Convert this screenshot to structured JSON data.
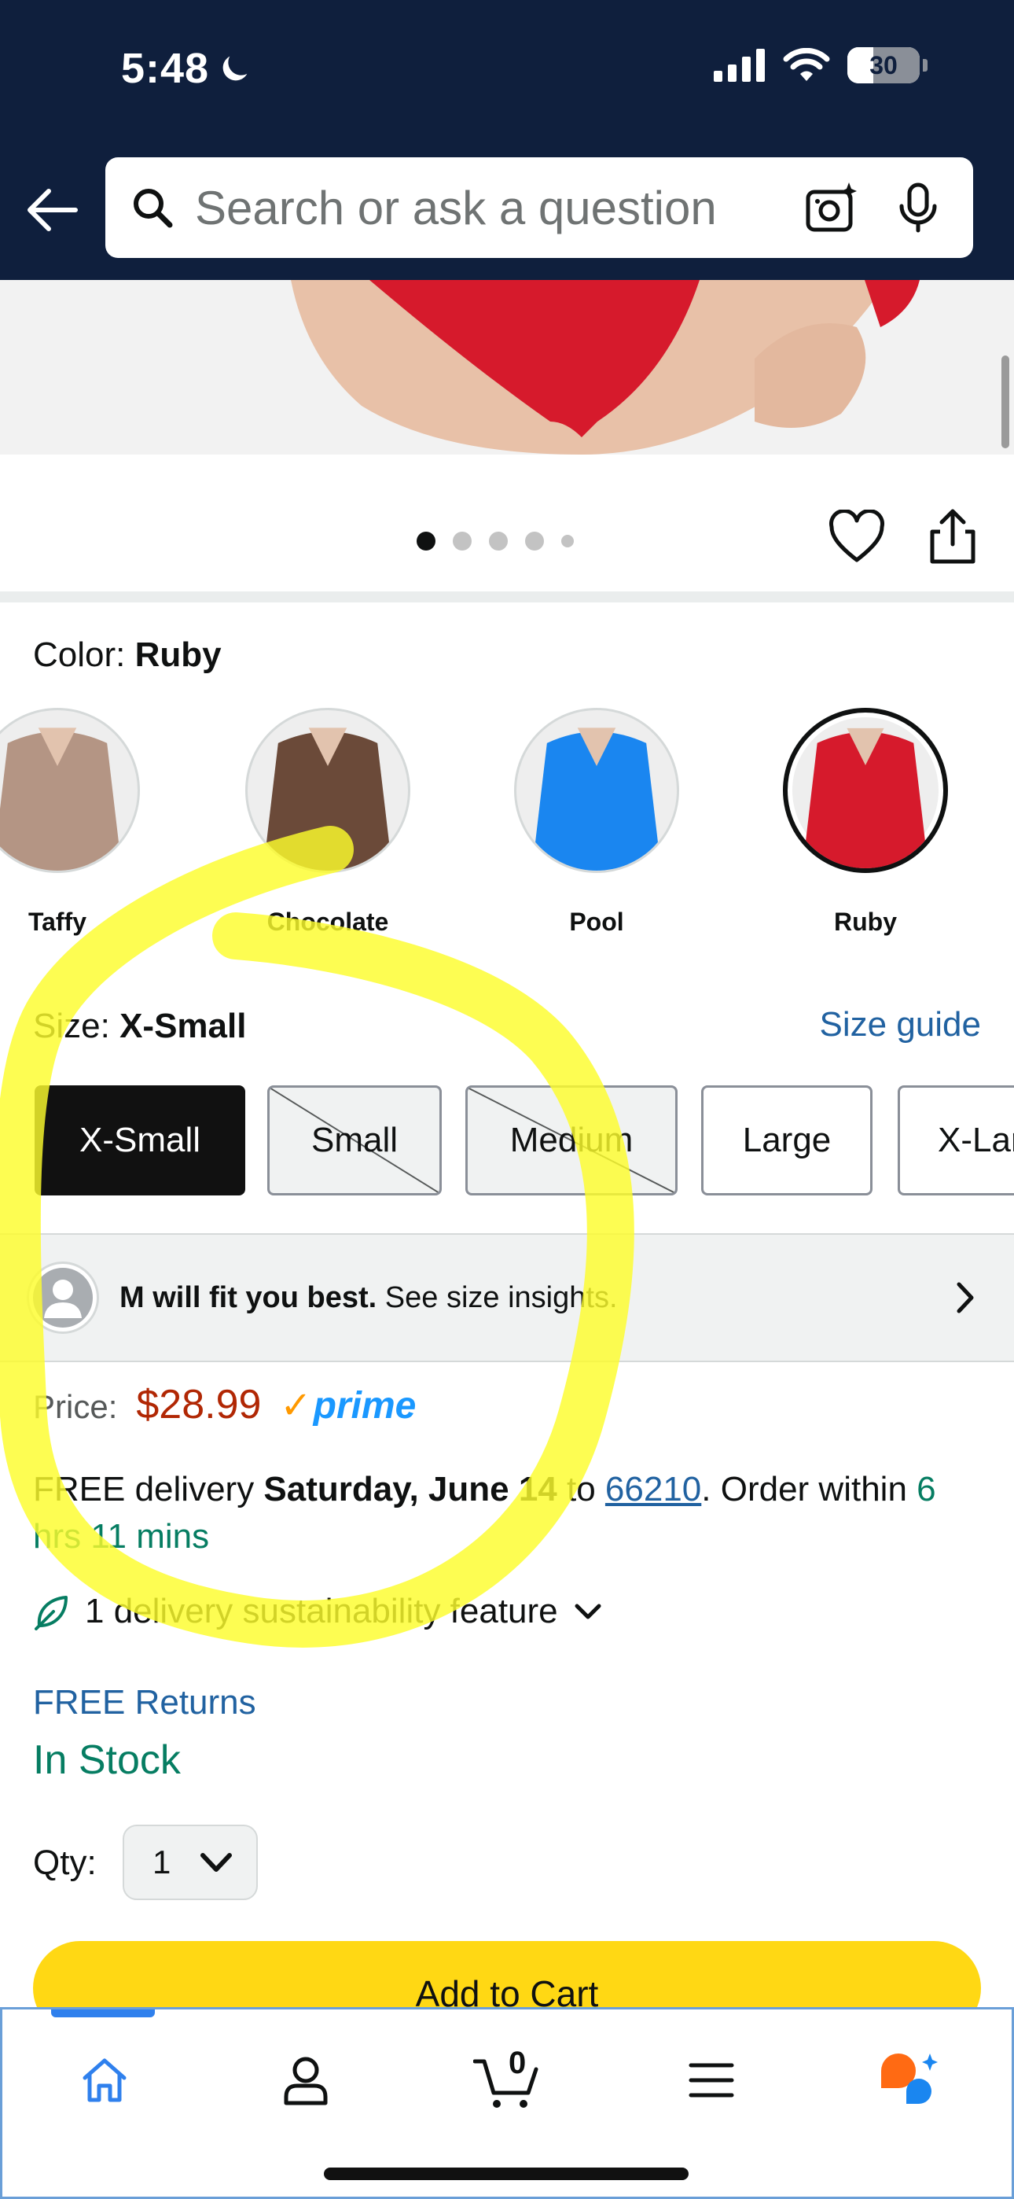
{
  "status_bar": {
    "time": "5:48",
    "battery": "30"
  },
  "search": {
    "placeholder": "Search or ask a question"
  },
  "gallery": {
    "dot_count": 5,
    "active_index": 0
  },
  "color": {
    "label": "Color:",
    "selected": "Ruby",
    "swatches": [
      {
        "name": "Taffy",
        "color": "#b49584"
      },
      {
        "name": "Chocolate",
        "color": "#6b4a39"
      },
      {
        "name": "Pool",
        "color": "#1a86f0"
      },
      {
        "name": "Ruby",
        "color": "#d61a2c"
      }
    ]
  },
  "size": {
    "label": "Size:",
    "selected": "X-Small",
    "guide_link": "Size guide",
    "options": [
      "X-Small",
      "Small",
      "Medium",
      "Large",
      "X-Large"
    ]
  },
  "fit_insight": {
    "bold": "M will fit you best.",
    "link": "See size insights."
  },
  "price": {
    "label": "Price:",
    "amount": "$28.99",
    "badge": "prime"
  },
  "delivery": {
    "prefix": "FREE delivery ",
    "date": "Saturday, June 14",
    "to": " to ",
    "zip": "66210",
    "order_within": ". Order within ",
    "countdown": "6 hrs 11 mins"
  },
  "sustainability": {
    "label": "1 delivery sustainability feature"
  },
  "returns": {
    "label": "FREE Returns"
  },
  "stock": {
    "label": "In Stock"
  },
  "quantity": {
    "label": "Qty:",
    "value": "1"
  },
  "cart_button": {
    "label": "Add to Cart"
  },
  "bottom_nav": {
    "cart_count": "0"
  },
  "colors": {
    "header_bg": "#0f1f3d",
    "accent_link": "#2162a1",
    "price": "#b12704",
    "stock_green": "#067d62",
    "cart_button": "#ffd814",
    "annotation": "#fcfc2c"
  }
}
